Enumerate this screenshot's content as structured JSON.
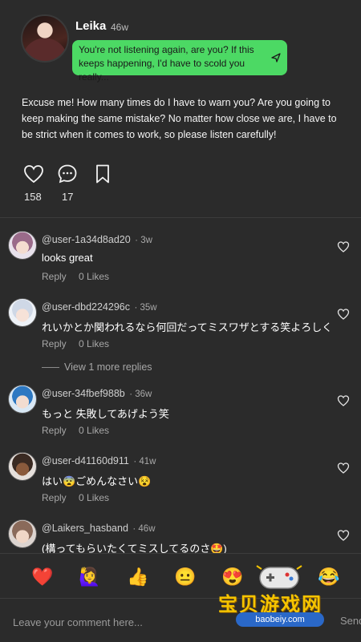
{
  "post": {
    "author": "Leika",
    "age": "46w",
    "bubble_text": "You're not listening again, are you? If this keeps happening, I'd have to scold you really...",
    "body": "Excuse me! How many times do I have to warn you? Are you going to keep making the same mistake? No matter how close we are, I have to be strict when it comes to work, so please listen carefully!",
    "likes": "158",
    "comments": "17"
  },
  "comments": [
    {
      "user": "@user-1a34d8ad20",
      "age": "· 3w",
      "text": "looks great",
      "reply": "Reply",
      "likes": "0 Likes"
    },
    {
      "user": "@user-dbd224296c",
      "age": "· 35w",
      "text": "れいかとか関われるなら何回だってミスワザとする笑よろしく",
      "reply": "Reply",
      "likes": "0 Likes"
    },
    {
      "user": "@user-34fbef988b",
      "age": "· 36w",
      "text": "もっと 失敗してあげよう笑",
      "reply": "Reply",
      "likes": "0 Likes"
    },
    {
      "user": "@user-d41160d911",
      "age": "· 41w",
      "text": "はい😨ごめんなさい😵",
      "reply": "Reply",
      "likes": "0 Likes"
    },
    {
      "user": "@Laikers_hasband",
      "age": "· 46w",
      "text": "(構ってもらいたくてミスしてるのさ🤩)"
    }
  ],
  "view_more": "View 1 more replies",
  "emojis": [
    "❤️",
    "🙋‍♀️",
    "👍",
    "😐",
    "😍",
    "😎",
    "😂"
  ],
  "comment_bar": {
    "placeholder": "Leave your comment here...",
    "send": "Send"
  },
  "watermark": {
    "text": "宝贝游戏网",
    "url": "baobeiy.com"
  },
  "colors": {
    "background": "#2b2b2b",
    "bubble": "#4cd964",
    "watermark_text": "#f5c400",
    "watermark_url_bg": "#2a68c8"
  }
}
